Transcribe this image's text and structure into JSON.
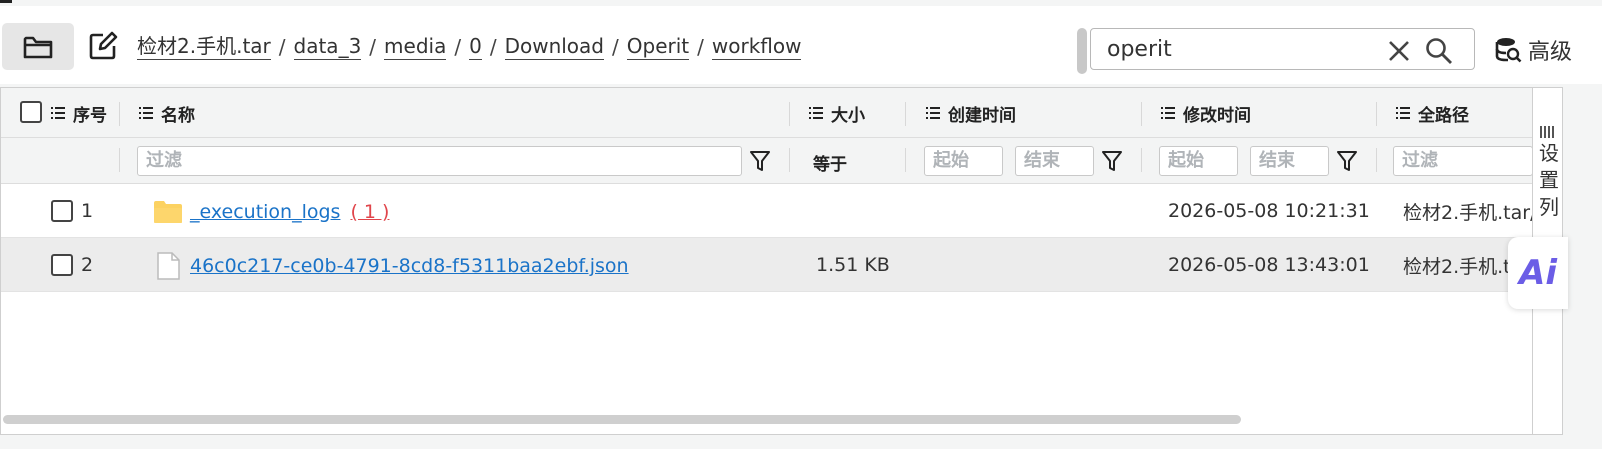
{
  "toolbar": {
    "breadcrumb": [
      "检材2.手机.tar",
      "data_3",
      "media",
      "0",
      "Download",
      "Operit",
      "workflow"
    ],
    "breadcrumb_sep": "/",
    "search_value": "operit",
    "advanced_label": "高级",
    "folder_icon": "folder-icon",
    "edit_icon": "edit-icon"
  },
  "columns": {
    "index": "序号",
    "name": "名称",
    "size": "大小",
    "created": "创建时间",
    "modified": "修改时间",
    "path": "全路径"
  },
  "filters": {
    "name_placeholder": "过滤",
    "size_op": "等于",
    "created_start": "起始",
    "created_end": "结束",
    "modified_start": "起始",
    "modified_end": "结束",
    "path_placeholder": "过滤"
  },
  "rows": [
    {
      "index": "1",
      "name": "_execution_logs",
      "count": "( 1 )",
      "size": "",
      "created": "",
      "modified": "2026-05-08 10:21:31",
      "path": "检材2.手机.tar/",
      "type": "folder"
    },
    {
      "index": "2",
      "name": "46c0c217-ce0b-4791-8cd8-f5311baa2ebf.json",
      "count": "",
      "size": "1.51 KB",
      "created": "",
      "modified": "2026-05-08 13:43:01",
      "path": "检材2.手机.t",
      "type": "file"
    }
  ],
  "side_panel": {
    "label": "设置列"
  },
  "ai_button": {
    "label": "Ai"
  },
  "colors": {
    "link": "#1a73c8",
    "count": "#e0444a",
    "ai": "#6b5de6"
  }
}
